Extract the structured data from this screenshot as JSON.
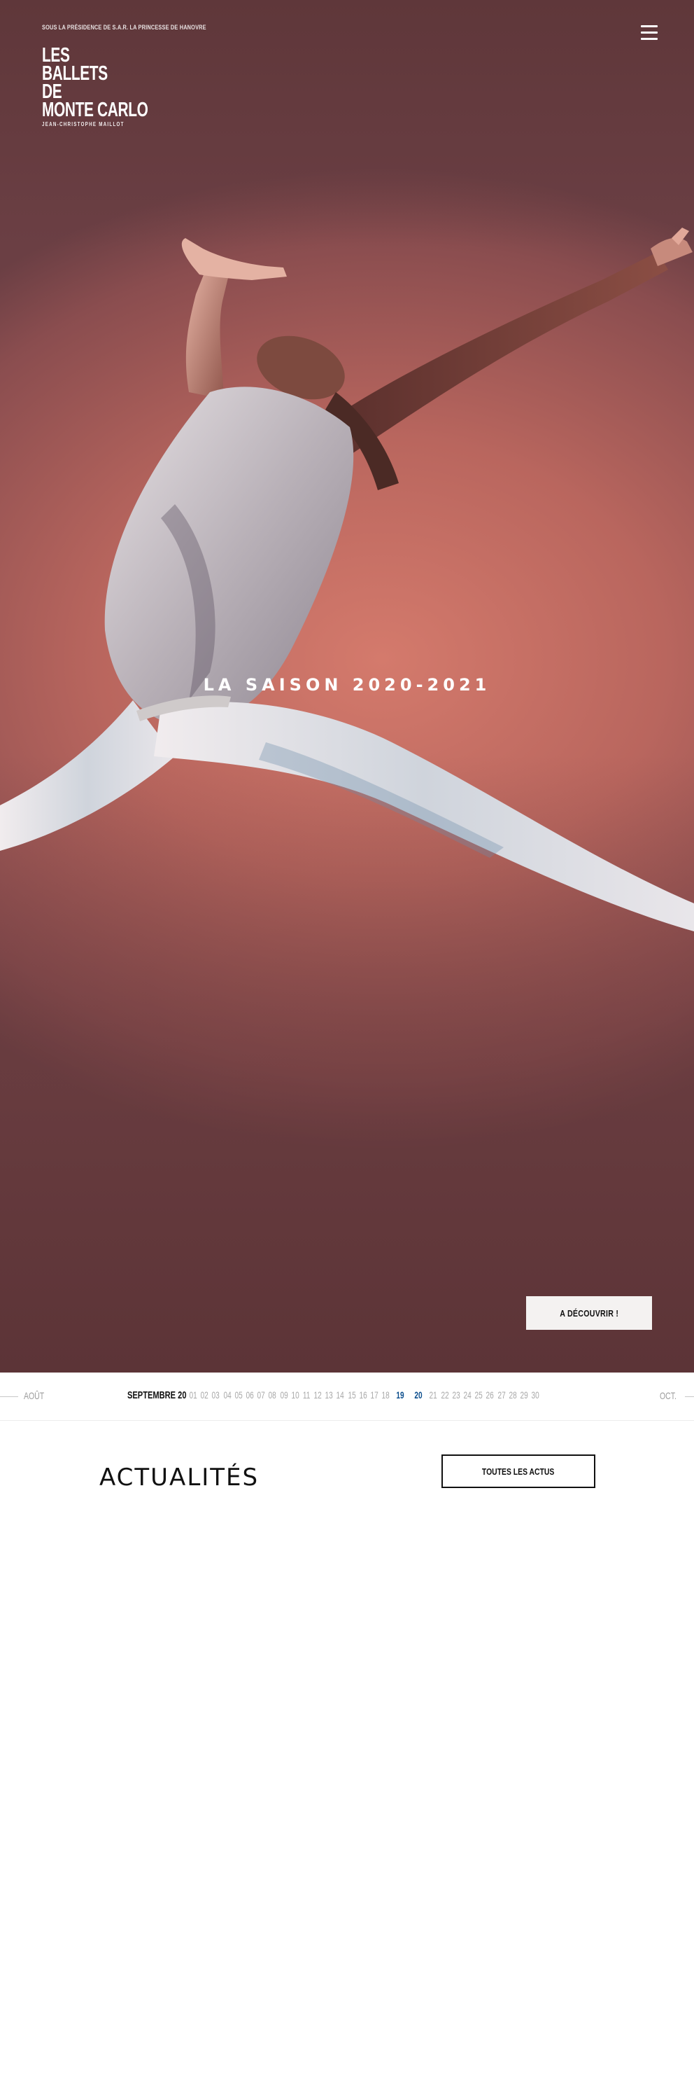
{
  "header": {
    "presidency": "SOUS LA PRÉSIDENCE DE S.A.R. LA PRINCESSE DE HANOVRE",
    "logo": {
      "lines": [
        "LES",
        "BALLETS",
        "DE",
        "MONTE CARLO"
      ],
      "subtitle": "JEAN-CHRISTOPHE MAILLOT"
    },
    "menu_icon": "hamburger-menu-icon"
  },
  "hero": {
    "title": "LA SAISON 2020-2021",
    "cta_label": "A DÉCOUVRIR !",
    "background_colors": [
      "#d47a6c",
      "#8a4d4f",
      "#5f373a"
    ]
  },
  "calendar": {
    "prev_month": "AOÛT",
    "current_month": "SEPTEMBRE 20",
    "next_month": "OCT.",
    "days": [
      "01",
      "02",
      "03",
      "04",
      "05",
      "06",
      "07",
      "08",
      "09",
      "10",
      "11",
      "12",
      "13",
      "14",
      "15",
      "16",
      "17",
      "18",
      "19",
      "20",
      "21",
      "22",
      "23",
      "24",
      "25",
      "26",
      "27",
      "28",
      "29",
      "30"
    ],
    "event_days": [
      "19",
      "20"
    ],
    "event_color": "#0b4d8c"
  },
  "news": {
    "title": "ACTUALITÉS",
    "all_label": "TOUTES LES ACTUS"
  }
}
